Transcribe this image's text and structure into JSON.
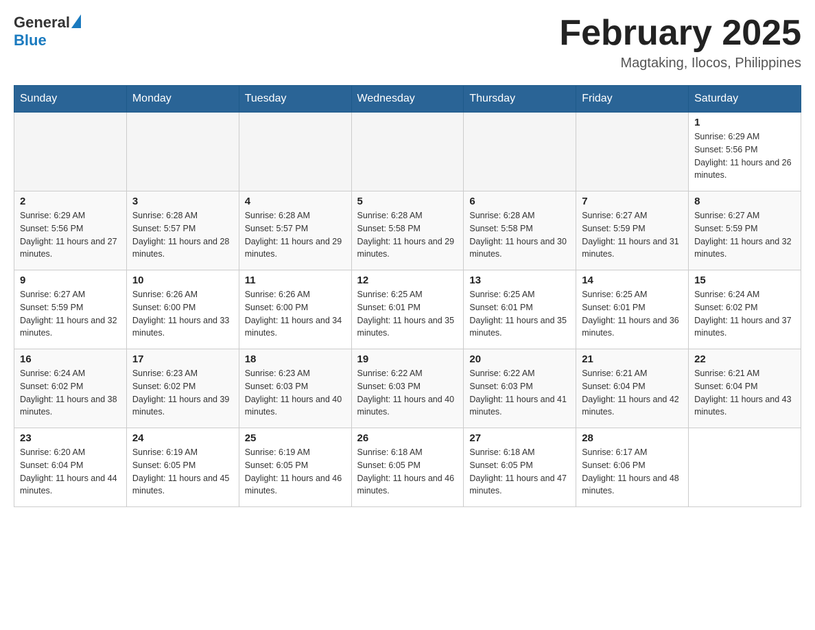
{
  "header": {
    "logo": {
      "general": "General",
      "blue": "Blue"
    },
    "title": "February 2025",
    "location": "Magtaking, Ilocos, Philippines"
  },
  "weekdays": [
    "Sunday",
    "Monday",
    "Tuesday",
    "Wednesday",
    "Thursday",
    "Friday",
    "Saturday"
  ],
  "weeks": [
    [
      {
        "day": "",
        "info": ""
      },
      {
        "day": "",
        "info": ""
      },
      {
        "day": "",
        "info": ""
      },
      {
        "day": "",
        "info": ""
      },
      {
        "day": "",
        "info": ""
      },
      {
        "day": "",
        "info": ""
      },
      {
        "day": "1",
        "info": "Sunrise: 6:29 AM\nSunset: 5:56 PM\nDaylight: 11 hours and 26 minutes."
      }
    ],
    [
      {
        "day": "2",
        "info": "Sunrise: 6:29 AM\nSunset: 5:56 PM\nDaylight: 11 hours and 27 minutes."
      },
      {
        "day": "3",
        "info": "Sunrise: 6:28 AM\nSunset: 5:57 PM\nDaylight: 11 hours and 28 minutes."
      },
      {
        "day": "4",
        "info": "Sunrise: 6:28 AM\nSunset: 5:57 PM\nDaylight: 11 hours and 29 minutes."
      },
      {
        "day": "5",
        "info": "Sunrise: 6:28 AM\nSunset: 5:58 PM\nDaylight: 11 hours and 29 minutes."
      },
      {
        "day": "6",
        "info": "Sunrise: 6:28 AM\nSunset: 5:58 PM\nDaylight: 11 hours and 30 minutes."
      },
      {
        "day": "7",
        "info": "Sunrise: 6:27 AM\nSunset: 5:59 PM\nDaylight: 11 hours and 31 minutes."
      },
      {
        "day": "8",
        "info": "Sunrise: 6:27 AM\nSunset: 5:59 PM\nDaylight: 11 hours and 32 minutes."
      }
    ],
    [
      {
        "day": "9",
        "info": "Sunrise: 6:27 AM\nSunset: 5:59 PM\nDaylight: 11 hours and 32 minutes."
      },
      {
        "day": "10",
        "info": "Sunrise: 6:26 AM\nSunset: 6:00 PM\nDaylight: 11 hours and 33 minutes."
      },
      {
        "day": "11",
        "info": "Sunrise: 6:26 AM\nSunset: 6:00 PM\nDaylight: 11 hours and 34 minutes."
      },
      {
        "day": "12",
        "info": "Sunrise: 6:25 AM\nSunset: 6:01 PM\nDaylight: 11 hours and 35 minutes."
      },
      {
        "day": "13",
        "info": "Sunrise: 6:25 AM\nSunset: 6:01 PM\nDaylight: 11 hours and 35 minutes."
      },
      {
        "day": "14",
        "info": "Sunrise: 6:25 AM\nSunset: 6:01 PM\nDaylight: 11 hours and 36 minutes."
      },
      {
        "day": "15",
        "info": "Sunrise: 6:24 AM\nSunset: 6:02 PM\nDaylight: 11 hours and 37 minutes."
      }
    ],
    [
      {
        "day": "16",
        "info": "Sunrise: 6:24 AM\nSunset: 6:02 PM\nDaylight: 11 hours and 38 minutes."
      },
      {
        "day": "17",
        "info": "Sunrise: 6:23 AM\nSunset: 6:02 PM\nDaylight: 11 hours and 39 minutes."
      },
      {
        "day": "18",
        "info": "Sunrise: 6:23 AM\nSunset: 6:03 PM\nDaylight: 11 hours and 40 minutes."
      },
      {
        "day": "19",
        "info": "Sunrise: 6:22 AM\nSunset: 6:03 PM\nDaylight: 11 hours and 40 minutes."
      },
      {
        "day": "20",
        "info": "Sunrise: 6:22 AM\nSunset: 6:03 PM\nDaylight: 11 hours and 41 minutes."
      },
      {
        "day": "21",
        "info": "Sunrise: 6:21 AM\nSunset: 6:04 PM\nDaylight: 11 hours and 42 minutes."
      },
      {
        "day": "22",
        "info": "Sunrise: 6:21 AM\nSunset: 6:04 PM\nDaylight: 11 hours and 43 minutes."
      }
    ],
    [
      {
        "day": "23",
        "info": "Sunrise: 6:20 AM\nSunset: 6:04 PM\nDaylight: 11 hours and 44 minutes."
      },
      {
        "day": "24",
        "info": "Sunrise: 6:19 AM\nSunset: 6:05 PM\nDaylight: 11 hours and 45 minutes."
      },
      {
        "day": "25",
        "info": "Sunrise: 6:19 AM\nSunset: 6:05 PM\nDaylight: 11 hours and 46 minutes."
      },
      {
        "day": "26",
        "info": "Sunrise: 6:18 AM\nSunset: 6:05 PM\nDaylight: 11 hours and 46 minutes."
      },
      {
        "day": "27",
        "info": "Sunrise: 6:18 AM\nSunset: 6:05 PM\nDaylight: 11 hours and 47 minutes."
      },
      {
        "day": "28",
        "info": "Sunrise: 6:17 AM\nSunset: 6:06 PM\nDaylight: 11 hours and 48 minutes."
      },
      {
        "day": "",
        "info": ""
      }
    ]
  ]
}
